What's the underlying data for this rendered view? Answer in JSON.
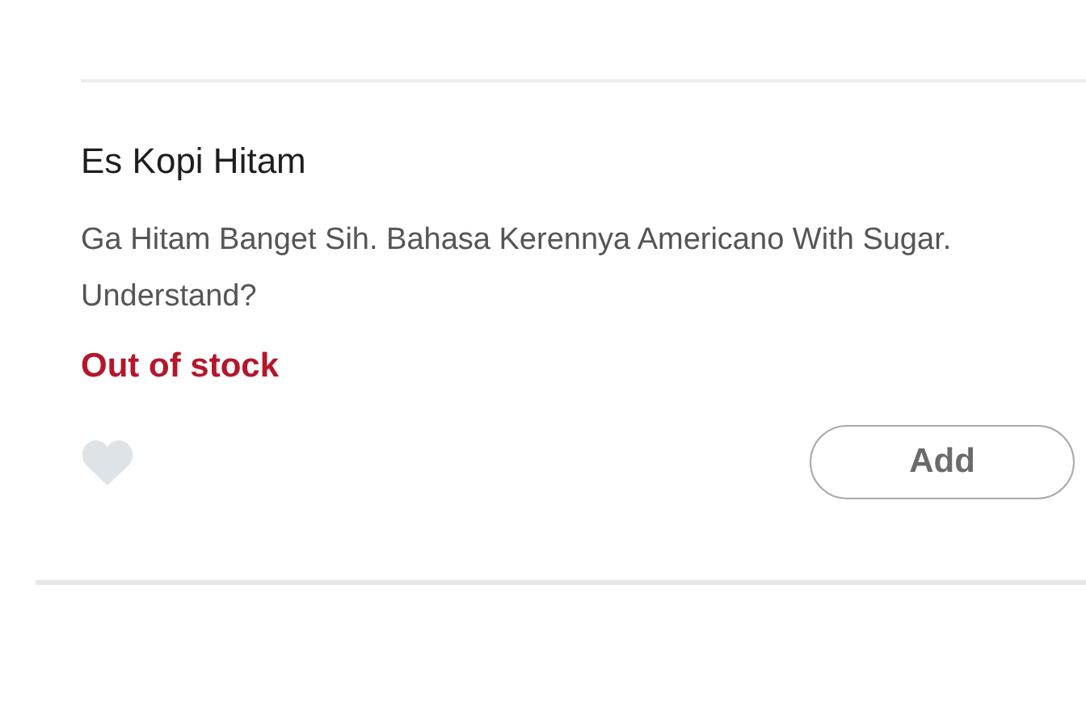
{
  "product": {
    "name": "Es Kopi Hitam",
    "description": "Ga Hitam Banget Sih. Bahasa Kerennya Americano With Sugar. Understand?",
    "stock_status": "Out of stock",
    "favorited": false,
    "add_button": "Add"
  }
}
